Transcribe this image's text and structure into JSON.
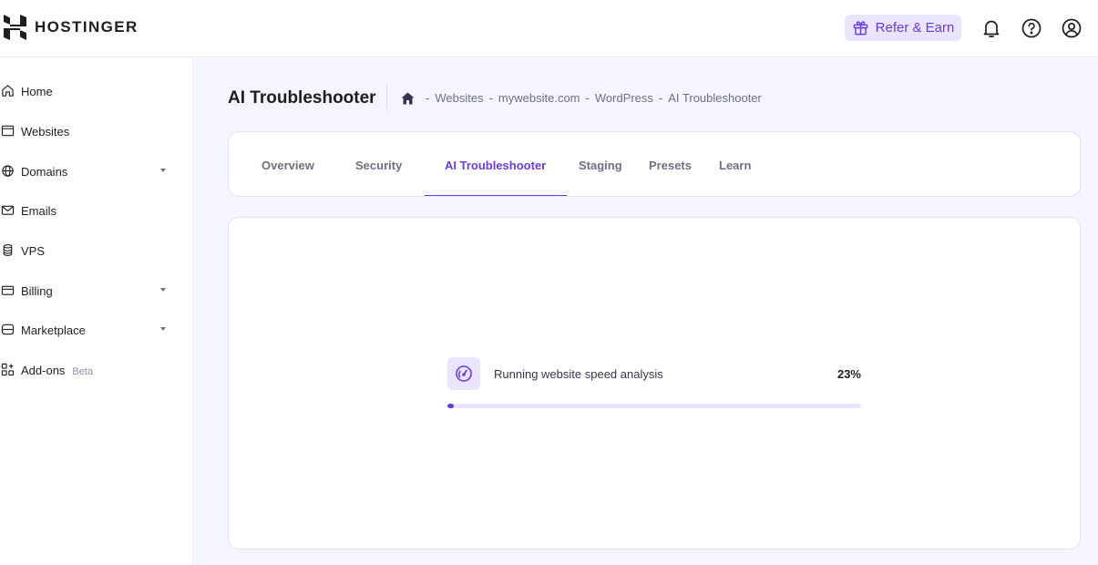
{
  "header": {
    "brand": "HOSTINGER",
    "refer_label": "Refer & Earn",
    "accent_color": "#673de6",
    "icons": [
      "bell-icon",
      "help-icon",
      "account-icon"
    ]
  },
  "sidebar": {
    "items": [
      {
        "label": "Home",
        "icon": "home-icon"
      },
      {
        "label": "Websites",
        "icon": "browser-window-icon"
      },
      {
        "label": "Domains",
        "icon": "globe-icon",
        "expandable": true
      },
      {
        "label": "Emails",
        "icon": "mail-icon"
      },
      {
        "label": "VPS",
        "icon": "server-icon"
      },
      {
        "label": "Billing",
        "icon": "credit-card-icon",
        "expandable": true
      },
      {
        "label": "Marketplace",
        "icon": "storefront-icon",
        "expandable": true
      },
      {
        "label": "Add-ons",
        "icon": "add-ons-grid-icon",
        "badge": "Beta"
      }
    ]
  },
  "page": {
    "title": "AI Troubleshooter",
    "breadcrumb": [
      "Websites",
      "mywebsite.com",
      "WordPress",
      "AI Troubleshooter"
    ],
    "breadcrumb_separator": "-"
  },
  "tabs": [
    {
      "label": "Overview",
      "active": false
    },
    {
      "label": "Security",
      "active": false
    },
    {
      "label": "AI Troubleshooter",
      "active": true
    },
    {
      "label": "Staging",
      "active": false
    },
    {
      "label": "Presets",
      "active": false
    },
    {
      "label": "Learn",
      "active": false
    }
  ],
  "analysis": {
    "label": "Running website speed analysis",
    "percent_text": "23%",
    "progress_fraction": 0.016,
    "icon": "speedometer-icon"
  }
}
